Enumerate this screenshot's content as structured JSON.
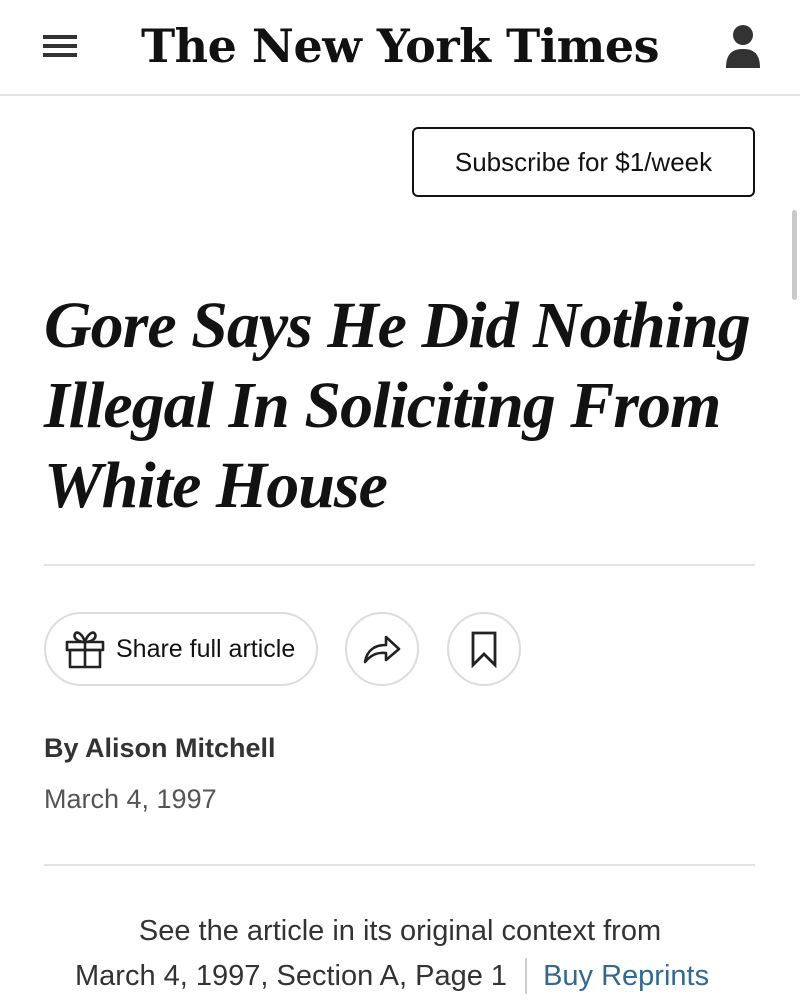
{
  "header": {
    "logo_text": "The New York Times",
    "menu_icon": "hamburger-menu-icon",
    "account_icon": "user-account-icon"
  },
  "subscribe": {
    "label": "Subscribe for $1/week"
  },
  "article": {
    "headline": "Gore Says He Did Nothing Illegal In Soliciting From White House",
    "byline": "By Alison Mitchell",
    "date": "March 4, 1997"
  },
  "actions": {
    "share_label": "Share full article",
    "share_icon": "gift-icon",
    "forward_icon": "share-arrow-icon",
    "save_icon": "bookmark-icon"
  },
  "context": {
    "line1": "See the article in its original context from",
    "line2": "March 4, 1997, Section A, Page 1",
    "reprints_label": "Buy Reprints"
  },
  "colors": {
    "text": "#121212",
    "link": "#326891",
    "divider": "#e2e2e2"
  }
}
